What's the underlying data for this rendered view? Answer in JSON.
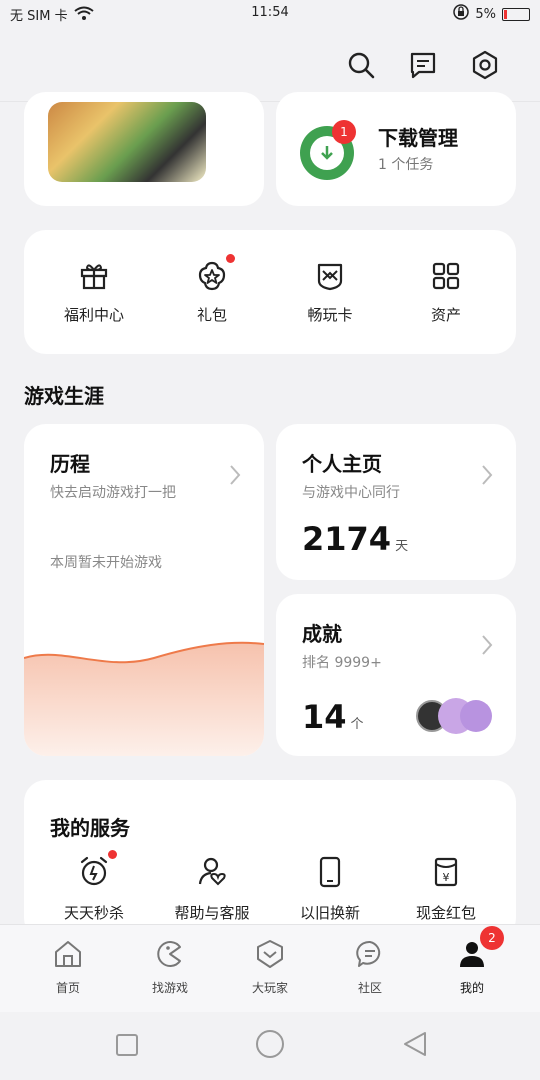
{
  "status_bar": {
    "sim": "无 SIM 卡",
    "time": "11:54",
    "battery": "5%"
  },
  "download": {
    "title": "下载管理",
    "subtitle": "1 个任务",
    "badge": "1"
  },
  "quick_items": [
    "福利中心",
    "礼包",
    "畅玩卡",
    "资产"
  ],
  "section_title": "游戏生涯",
  "history": {
    "title": "历程",
    "subtitle": "快去启动游戏打一把",
    "note": "本周暂未开始游戏"
  },
  "personal": {
    "title": "个人主页",
    "subtitle": "与游戏中心同行",
    "value": "2174",
    "unit": "天"
  },
  "achievement": {
    "title": "成就",
    "subtitle": "排名 9999+",
    "value": "14",
    "unit": "个"
  },
  "services": {
    "title": "我的服务",
    "items": [
      "天天秒杀",
      "帮助与客服",
      "以旧换新",
      "现金红包"
    ]
  },
  "bottom_nav": {
    "items": [
      "首页",
      "找游戏",
      "大玩家",
      "社区",
      "我的"
    ],
    "badge": "2"
  },
  "colors": {
    "accent_green": "#3fa150",
    "badge_red": "#e33333",
    "chart_orange": "#ee7a4a"
  }
}
